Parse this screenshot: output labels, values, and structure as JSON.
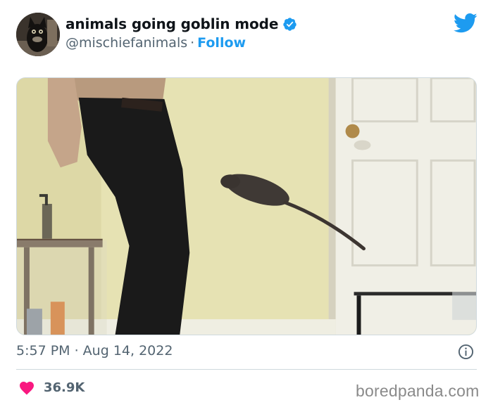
{
  "author": {
    "display_name": "animals going goblin mode",
    "handle": "@mischiefanimals",
    "separator": "·",
    "follow_label": "Follow",
    "verified": true,
    "avatar_icon": "cat-avatar"
  },
  "brand": {
    "icon": "twitter-bird-icon",
    "color": "#1d9bf0"
  },
  "media": {
    "type": "video-frame",
    "content": "rat-leaping-in-room"
  },
  "meta": {
    "timestamp": "5:57 PM · Aug 14, 2022"
  },
  "engagement": {
    "likes": "36.9K",
    "heart_color": "#f91880"
  },
  "watermark": "boredpanda.com"
}
